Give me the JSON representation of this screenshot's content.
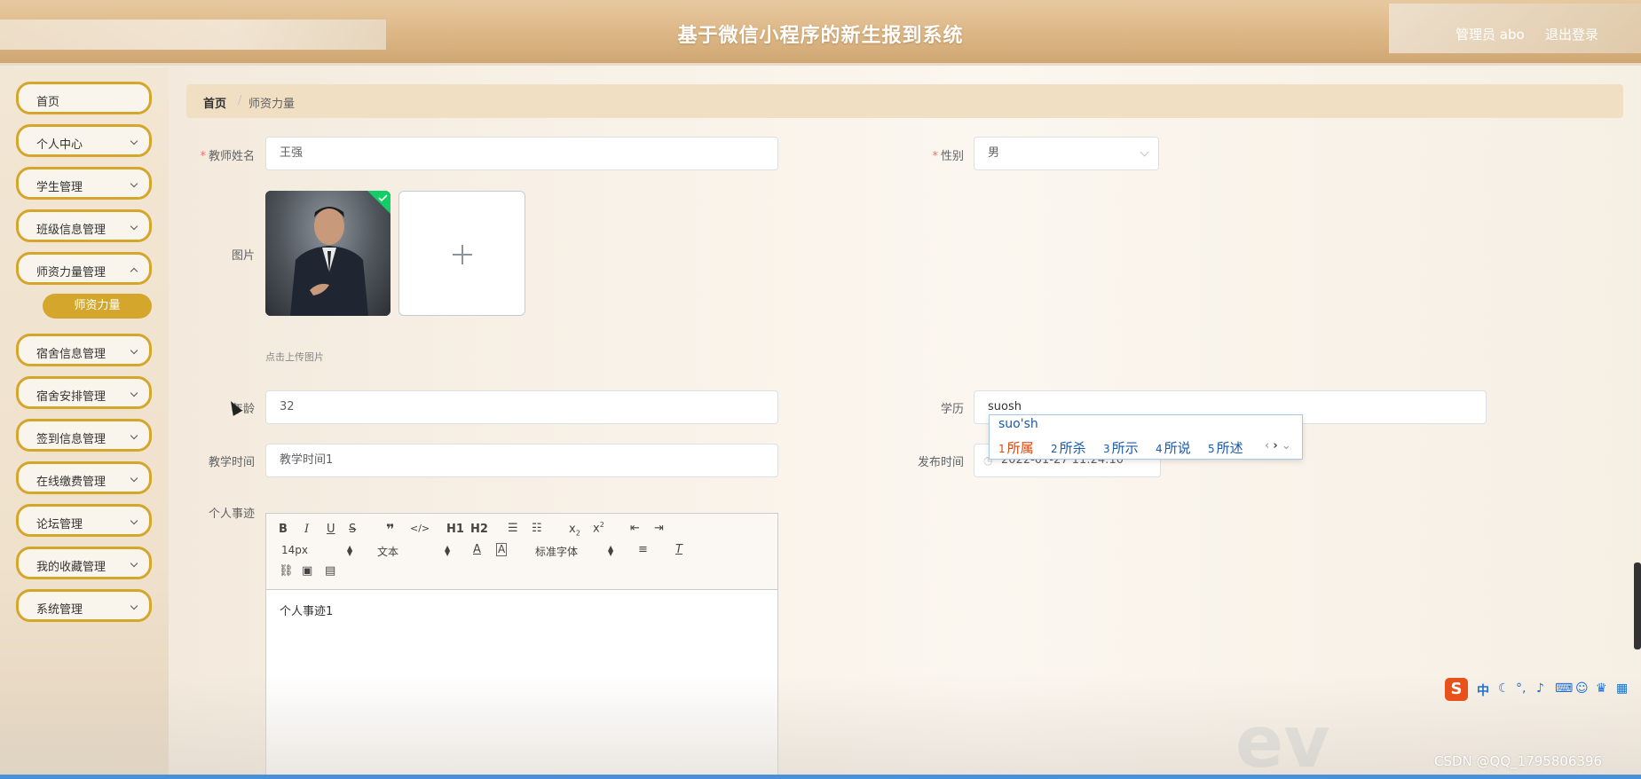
{
  "header": {
    "title": "基于微信小程序的新生报到系统",
    "user": "管理员 abo",
    "logout": "退出登录"
  },
  "sidebar": {
    "items": [
      {
        "label": "首页",
        "has_children": false
      },
      {
        "label": "个人中心",
        "has_children": true
      },
      {
        "label": "学生管理",
        "has_children": true
      },
      {
        "label": "班级信息管理",
        "has_children": true
      },
      {
        "label": "师资力量管理",
        "has_children": true
      },
      {
        "label": "宿舍信息管理",
        "has_children": true
      },
      {
        "label": "宿舍安排管理",
        "has_children": true
      },
      {
        "label": "签到信息管理",
        "has_children": true
      },
      {
        "label": "在线缴费管理",
        "has_children": true
      },
      {
        "label": "论坛管理",
        "has_children": true
      },
      {
        "label": "我的收藏管理",
        "has_children": true
      },
      {
        "label": "系统管理",
        "has_children": true
      }
    ],
    "active_sub": "师资力量"
  },
  "breadcrumb": {
    "home": "首页",
    "separator": "/",
    "current": "师资力量"
  },
  "form": {
    "teacher_name_label": "教师姓名",
    "teacher_name_value": "王强",
    "gender_label": "性别",
    "gender_value": "男",
    "image_label": "图片",
    "upload_hint": "点击上传图片",
    "age_label": "年龄",
    "age_value": "32",
    "education_label": "学历",
    "education_value": "suosh",
    "teaching_time_label": "教学时间",
    "teaching_time_value": "教学时间1",
    "publish_time_label": "发布时间",
    "publish_time_value": "2022-01-27 11:24:10",
    "bio_label": "个人事迹",
    "bio_value": "个人事迹1",
    "required_mark": "*"
  },
  "editor_toolbar": {
    "font_size": "14px",
    "text_style": "文本",
    "font_family": "标准字体",
    "h1": "H1",
    "h2": "H2"
  },
  "ime": {
    "pinyin": "suo'sh",
    "candidates": [
      {
        "n": "1",
        "text": "所属"
      },
      {
        "n": "2",
        "text": "所杀"
      },
      {
        "n": "3",
        "text": "所示"
      },
      {
        "n": "4",
        "text": "所说"
      },
      {
        "n": "5",
        "text": "所述"
      }
    ],
    "bar_mode": "中",
    "logo": "S"
  },
  "watermark": "CSDN @QQ_1795806396",
  "ev_mark": "ev",
  "colors": {
    "accent": "#d4a72c",
    "header": "#dcb685",
    "required": "#f56c6c"
  }
}
